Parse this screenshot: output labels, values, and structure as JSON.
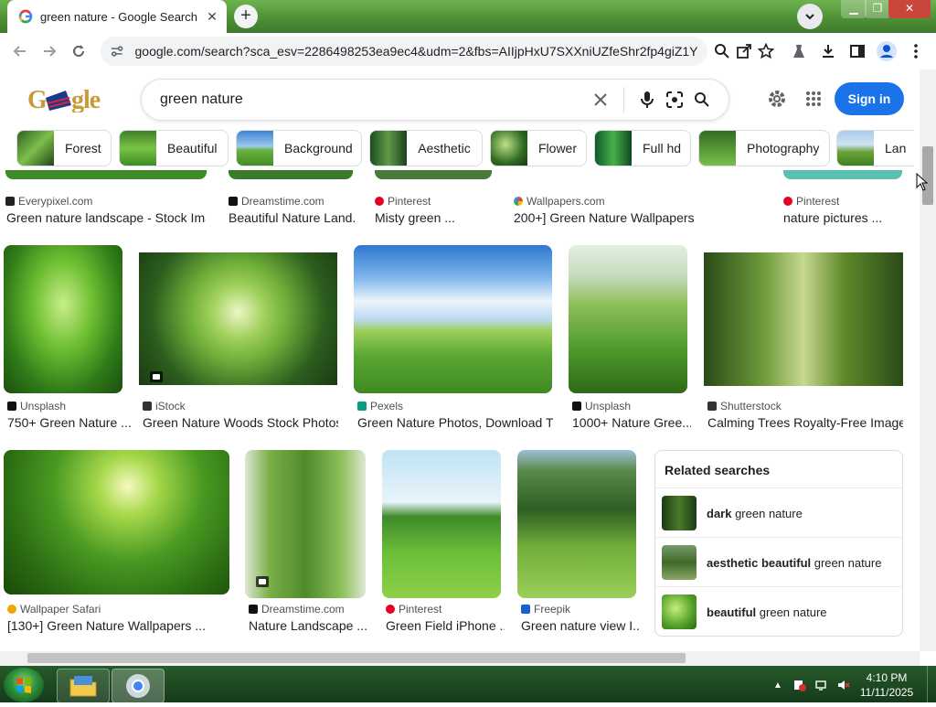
{
  "browser": {
    "tab_title": "green nature - Google Search",
    "new_tab_symbol": "+",
    "url": "google.com/search?sca_esv=2286498253ea9ec4&udm=2&fbs=AIIjpHxU7SXXniUZfeShr2fp4giZ1Y6...",
    "icons": [
      "back-icon",
      "forward-icon",
      "reload-icon",
      "site-info-icon",
      "zoom-icon",
      "share-icon",
      "bookmark-star-icon",
      "extension-icon",
      "download-icon",
      "side-panel-icon",
      "profile-icon",
      "menu-icon"
    ]
  },
  "google": {
    "query": "green nature",
    "sign_in": "Sign in",
    "colors": {
      "accent": "#1a73e8"
    }
  },
  "chips": [
    {
      "label": "Forest",
      "color": "#3d7a2a"
    },
    {
      "label": "Beautiful",
      "color": "#4a9a2e"
    },
    {
      "label": "Background",
      "color": "#5bb03a"
    },
    {
      "label": "Aesthetic",
      "color": "#2f6b2a"
    },
    {
      "label": "Flower",
      "color": "#3c8a33"
    },
    {
      "label": "Full hd",
      "color": "#1f7a2f"
    },
    {
      "label": "Photography",
      "color": "#3f8f2c"
    },
    {
      "label": "Lan",
      "color": "#5f9a3a"
    }
  ],
  "row1": [
    {
      "source": "Everypixel.com",
      "title": "Green nature landscape - Stock Ima..."
    },
    {
      "source": "Dreamstime.com",
      "title": "Beautiful Nature Land..."
    },
    {
      "source": "Pinterest",
      "title": "Misty green ..."
    },
    {
      "source": "Wallpapers.com",
      "title": "200+] Green Nature Wallpapers ..."
    },
    {
      "source": "Pinterest",
      "title": "nature pictures ..."
    }
  ],
  "row2": [
    {
      "source": "Unsplash",
      "title": "750+ Green Nature ..."
    },
    {
      "source": "iStock",
      "title": "Green Nature Woods Stock Photos..."
    },
    {
      "source": "Pexels",
      "title": "Green Nature Photos, Download T..."
    },
    {
      "source": "Unsplash",
      "title": "1000+ Nature Gree..."
    },
    {
      "source": "Shutterstock",
      "title": "Calming Trees Royalty-Free Image..."
    }
  ],
  "row3": [
    {
      "source": "Wallpaper Safari",
      "title": "[130+] Green Nature Wallpapers ..."
    },
    {
      "source": "Dreamstime.com",
      "title": "Nature Landscape ..."
    },
    {
      "source": "Pinterest",
      "title": "Green Field iPhone ..."
    },
    {
      "source": "Freepik",
      "title": "Green nature view I..."
    }
  ],
  "related": {
    "heading": "Related searches",
    "items": [
      {
        "bold": "dark",
        "rest": " green nature"
      },
      {
        "bold": "aesthetic beautiful",
        "rest": " green nature"
      },
      {
        "bold": "beautiful",
        "rest": " green nature"
      }
    ]
  },
  "taskbar": {
    "time": "4:10 PM",
    "date": "11/11/2025"
  }
}
